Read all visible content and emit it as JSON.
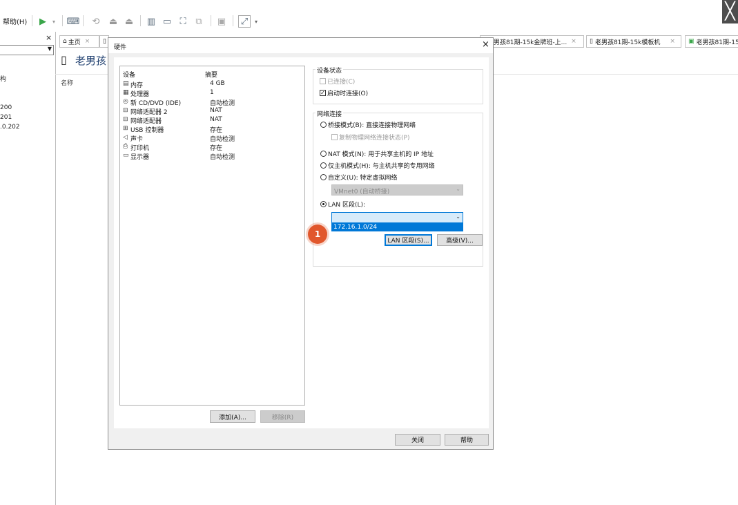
{
  "toolbar": {
    "help_menu": "帮助(H)"
  },
  "corner_close": "╳",
  "sidebar": {
    "close_glyph": "×",
    "items": [
      "构",
      "200",
      "201",
      ".0.202"
    ]
  },
  "main": {
    "column_name": "名称",
    "vm_title": "老男孩"
  },
  "tabs": [
    {
      "label": "主页",
      "close": "×"
    },
    {
      "label": "老男孩81期-15k金牌班-上...",
      "close": "×"
    },
    {
      "label": "老男孩81期-15k模板机",
      "close": "×"
    },
    {
      "label": "老男孩81期-15",
      "close": ""
    }
  ],
  "dialog": {
    "title": "硬件",
    "close_glyph": "×",
    "device_list": {
      "header_device": "设备",
      "header_summary": "摘要",
      "rows": [
        {
          "icon": "memory-icon",
          "name": "内存",
          "summary": "4 GB"
        },
        {
          "icon": "cpu-icon",
          "name": "处理器",
          "summary": "1"
        },
        {
          "icon": "cd-icon",
          "name": "新 CD/DVD (IDE)",
          "summary": "自动检测"
        },
        {
          "icon": "network-icon",
          "name": "网络适配器 2",
          "summary": "NAT"
        },
        {
          "icon": "network-icon",
          "name": "网络适配器",
          "summary": "NAT"
        },
        {
          "icon": "usb-icon",
          "name": "USB 控制器",
          "summary": "存在"
        },
        {
          "icon": "speaker-icon",
          "name": "声卡",
          "summary": "自动检测"
        },
        {
          "icon": "printer-icon",
          "name": "打印机",
          "summary": "存在"
        },
        {
          "icon": "monitor-icon",
          "name": "显示器",
          "summary": "自动检测"
        }
      ]
    },
    "add_button": "添加(A)...",
    "remove_button": "移除(R)",
    "device_status": {
      "title": "设备状态",
      "connected": "已连接(C)",
      "connect_on_power": "启动时连接(O)"
    },
    "network": {
      "title": "网络连接",
      "bridged": "桥接模式(B): 直接连接物理网络",
      "replicate": "复制物理网络连接状态(P)",
      "nat": "NAT 模式(N): 用于共享主机的 IP 地址",
      "host_only": "仅主机模式(H): 与主机共享的专用网络",
      "custom": "自定义(U): 特定虚拟网络",
      "custom_value": "VMnet0 (自动桥接)",
      "lan_segment": "LAN 区段(L):",
      "lan_value": "",
      "lan_option": "172.16.1.0/24",
      "lan_segments_button": "LAN 区段(S)...",
      "advanced_button": "高级(V)..."
    },
    "close_button": "关闭",
    "help_button": "帮助"
  },
  "annotation": {
    "step": "1"
  }
}
